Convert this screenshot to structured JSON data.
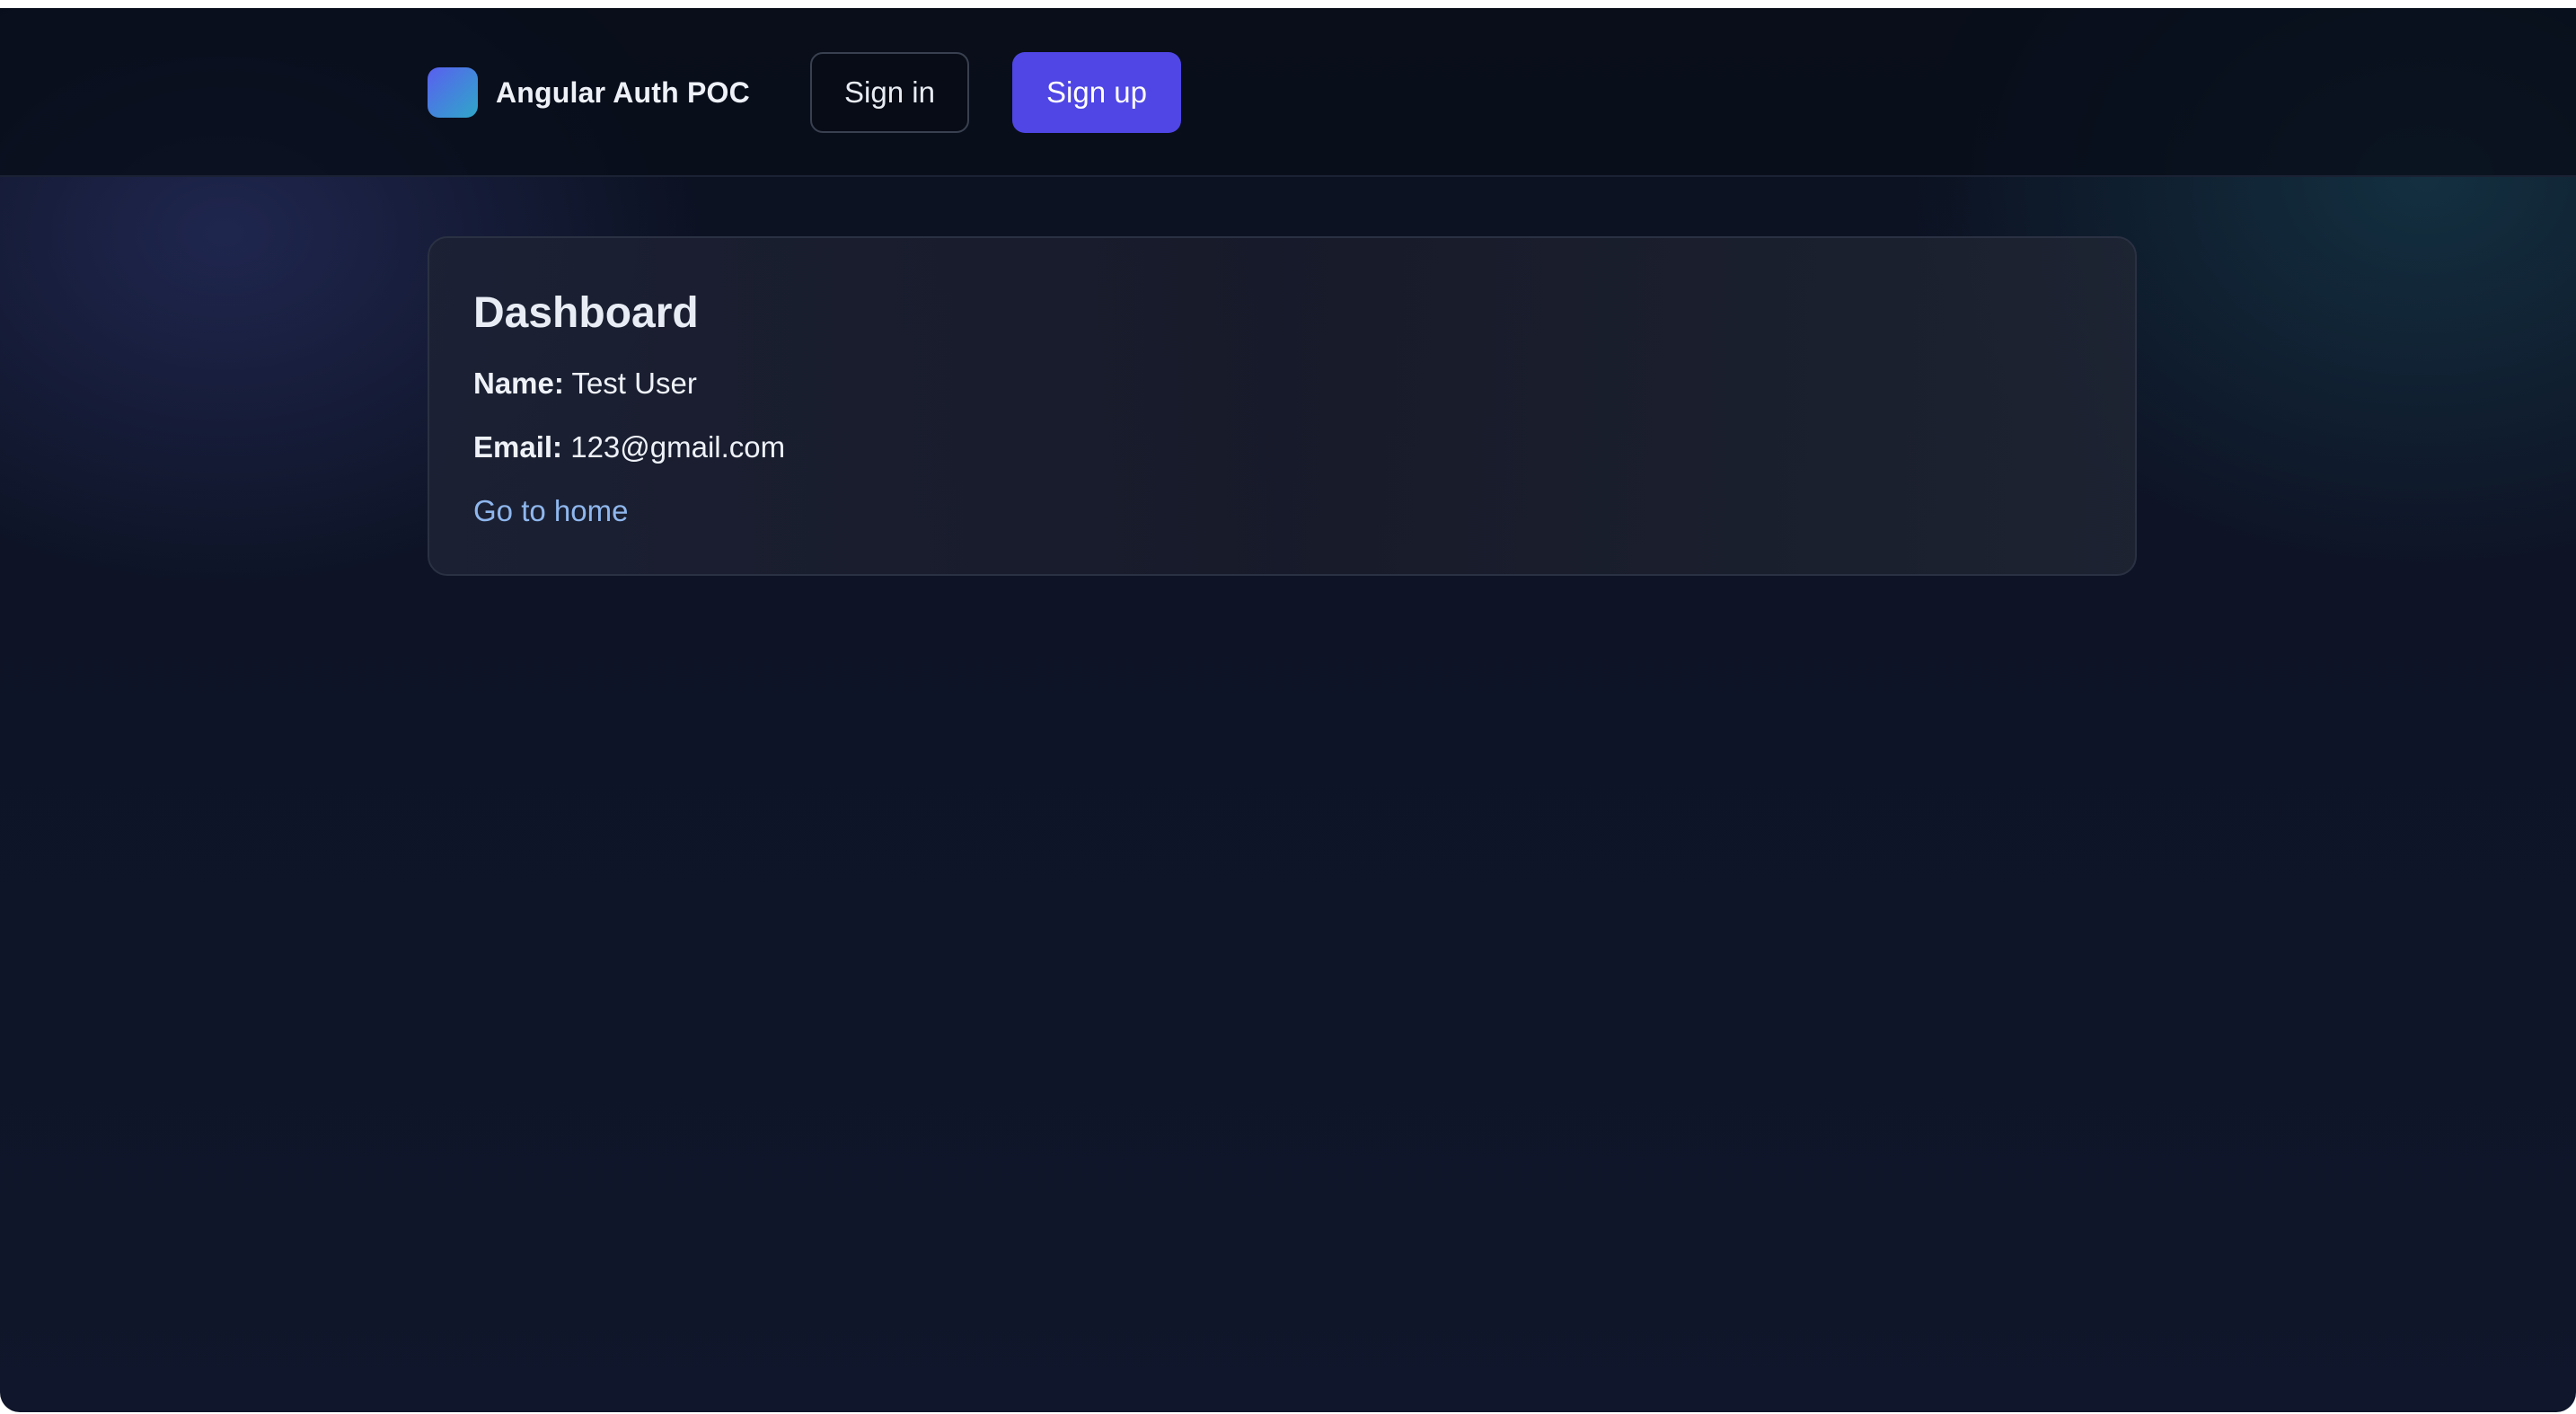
{
  "header": {
    "brand_name": "Angular Auth POC",
    "signin_label": "Sign in",
    "signup_label": "Sign up"
  },
  "dashboard": {
    "title": "Dashboard",
    "name_label": "Name:",
    "name_value": "Test User",
    "email_label": "Email:",
    "email_value": "123@gmail.com",
    "home_link": "Go to home"
  },
  "colors": {
    "accent": "#4f46e5",
    "link": "#8fb7ee",
    "background": "#0e1426"
  },
  "icons": {
    "logo": "app-logo-icon"
  }
}
